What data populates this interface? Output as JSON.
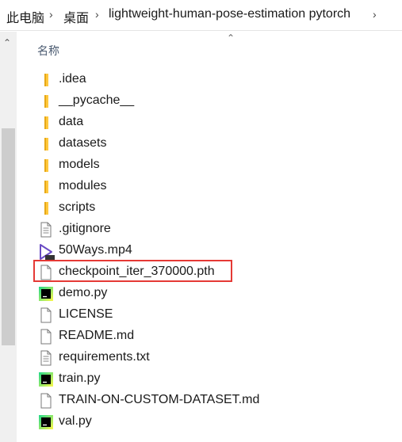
{
  "breadcrumb": {
    "items": [
      "此电脑",
      "桌面",
      "lightweight-human-pose-estimation pytorch"
    ],
    "separator": "›"
  },
  "list": {
    "column_header": "名称",
    "files": [
      {
        "name": ".idea",
        "icon": "folder-icon"
      },
      {
        "name": "__pycache__",
        "icon": "folder-icon"
      },
      {
        "name": "data",
        "icon": "folder-icon"
      },
      {
        "name": "datasets",
        "icon": "folder-icon"
      },
      {
        "name": "models",
        "icon": "folder-icon"
      },
      {
        "name": "modules",
        "icon": "folder-icon"
      },
      {
        "name": "scripts",
        "icon": "folder-icon"
      },
      {
        "name": ".gitignore",
        "icon": "text-file-icon"
      },
      {
        "name": "50Ways.mp4",
        "icon": "video-file-icon"
      },
      {
        "name": "checkpoint_iter_370000.pth",
        "icon": "blank-file-icon",
        "highlighted": true
      },
      {
        "name": "demo.py",
        "icon": "pycharm-file-icon"
      },
      {
        "name": "LICENSE",
        "icon": "blank-file-icon"
      },
      {
        "name": "README.md",
        "icon": "blank-file-icon"
      },
      {
        "name": "requirements.txt",
        "icon": "text-file-icon"
      },
      {
        "name": "train.py",
        "icon": "pycharm-file-icon"
      },
      {
        "name": "TRAIN-ON-CUSTOM-DATASET.md",
        "icon": "blank-file-icon"
      },
      {
        "name": "val.py",
        "icon": "pycharm-file-icon"
      }
    ]
  },
  "colors": {
    "folder": "#ffc83d",
    "highlight": "#e53935",
    "pycharm_green": "#21d789"
  }
}
